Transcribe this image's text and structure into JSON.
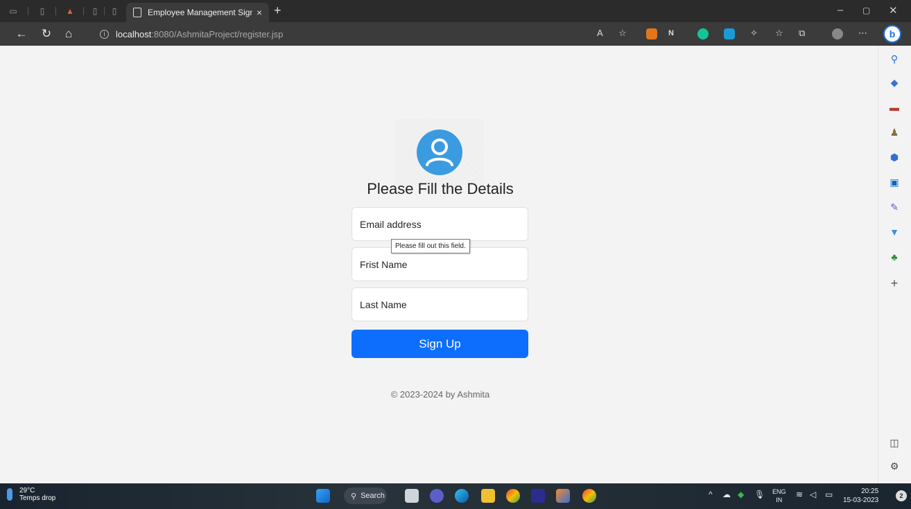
{
  "browser": {
    "active_tab_title": "Employee Management Sign up",
    "tab_close": "×",
    "new_tab": "+",
    "url_host": "localhost",
    "url_rest": ":8080/AshmitaProject/register.jsp",
    "window": {
      "minimize": "–",
      "maximize": "▢",
      "close": "✕"
    }
  },
  "page": {
    "heading": "Please Fill the Details",
    "fields": {
      "email_placeholder": "Email address",
      "first_name_placeholder": "Frist Name",
      "last_name_placeholder": "Last Name"
    },
    "tooltip": "Please fill out this field.",
    "signup_label": "Sign Up",
    "copyright": "© 2023-2024 by Ashmita"
  },
  "taskbar": {
    "temperature": "29°C",
    "weather_text": "Temps drop",
    "search_label": "Search",
    "lang_line1": "ENG",
    "lang_line2": "IN",
    "time": "20:25",
    "date": "15-03-2023",
    "notification_count": "2"
  },
  "colors": {
    "primary": "#0d6efd",
    "avatar": "#3b9be0",
    "tab_bar": "#2b2b2b"
  }
}
